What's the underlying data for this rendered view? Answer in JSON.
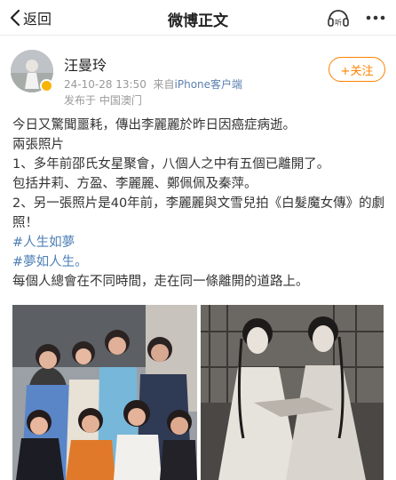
{
  "header": {
    "back_label": "返回",
    "title": "微博正文",
    "listen_badge": "听"
  },
  "post": {
    "author_name": "汪曼玲",
    "timestamp": "24-10-28 13:50",
    "source_prefix": "来自",
    "source_device": "iPhone客户端",
    "location": "发布于 中国澳门",
    "follow_label": "+关注",
    "lines": [
      "今日又驚聞噩耗，傳出李麗麗於昨日因癌症病逝。",
      "兩張照片",
      "1、多年前邵氏女星聚會，八個人之中有五個已離開了。",
      "包括井莉、方盈、李麗麗、鄭佩佩及秦萍。",
      "2、另一張照片是40年前，李麗麗與文雪兒拍《白髮魔女傳》的劇照！"
    ],
    "tags": [
      "#人生如夢",
      "#夢如人生。"
    ],
    "closing": "每個人總會在不同時間，走在同一條離開的道路上。"
  },
  "colors": {
    "accent": "#ff8200",
    "link": "#4d7fb6",
    "verified": "#f7b500"
  },
  "icons": [
    "chevron-left-icon",
    "listen-icon",
    "more-icon",
    "verified-icon"
  ]
}
